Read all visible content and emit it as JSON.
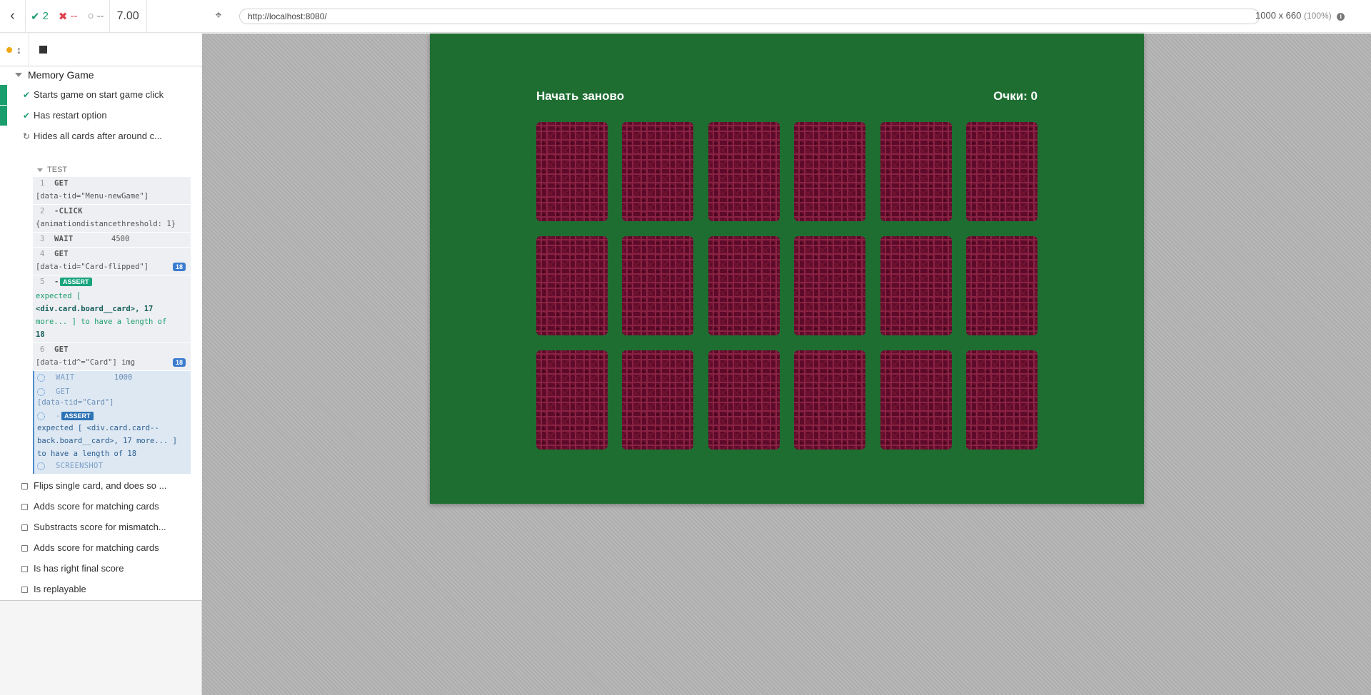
{
  "stats": {
    "passed": "2",
    "failed": "--",
    "pending": "--",
    "duration": "7.00"
  },
  "url": "http://localhost:8080/",
  "viewport": {
    "size": "1000 x 660",
    "scale": "(100%)"
  },
  "suite": {
    "title": "Memory Game"
  },
  "tests": [
    {
      "title": "Starts game on start game click",
      "state": "passed"
    },
    {
      "title": "Has restart option",
      "state": "passed"
    },
    {
      "title": "Hides all cards after around c...",
      "state": "running"
    },
    {
      "title": "Flips single card, and does so ...",
      "state": "pending"
    },
    {
      "title": "Adds score for matching cards",
      "state": "pending"
    },
    {
      "title": "Substracts score for mismatch...",
      "state": "pending"
    },
    {
      "title": "Adds score for matching cards",
      "state": "pending"
    },
    {
      "title": "Is has right final score",
      "state": "pending"
    },
    {
      "title": "Is replayable",
      "state": "pending"
    }
  ],
  "commands": {
    "header": "TEST",
    "c1": {
      "num": "1",
      "name": "GET",
      "msg": "[data-tid=\"Menu-newGame\"]"
    },
    "c2": {
      "num": "2",
      "name": "-CLICK",
      "msg": "{animationdistancethreshold: 1}"
    },
    "c3": {
      "num": "3",
      "name": "WAIT",
      "msg": "4500"
    },
    "c4": {
      "num": "4",
      "name": "GET",
      "msg": "[data-tid=\"Card-flipped\"]",
      "badge": "18"
    },
    "c5": {
      "num": "5",
      "name": "-",
      "tag": "ASSERT",
      "l1": "expected [",
      "l2": "<div.card.board__card>, 17",
      "l3": "more... ] to have a length of",
      "l4": "18"
    },
    "c6": {
      "num": "6",
      "name": "GET",
      "msg": "[data-tid^=\"Card\"] img",
      "badge": "18"
    },
    "c7": {
      "name": "WAIT",
      "msg": "1000"
    },
    "c8": {
      "name": "GET",
      "msg": "[data-tid=\"Card\"]"
    },
    "c9": {
      "name": "-",
      "tag": "ASSERT",
      "l1": "expected [ <div.card.card--",
      "l2": "back.board__card>, 17 more... ]",
      "l3": "to have a length of 18"
    },
    "c10": {
      "name": "SCREENSHOT"
    }
  },
  "game": {
    "restart_label": "Начать заново",
    "score_label": "Очки: 0",
    "card_count": 18,
    "colors": {
      "table": "#1e6e32",
      "card_back": "#5e0a2a"
    }
  },
  "colors": {
    "pass": "#1b9e6d",
    "fail": "#e0434d",
    "running_dot": "#f0a912",
    "badge": "#3c7ccf"
  }
}
